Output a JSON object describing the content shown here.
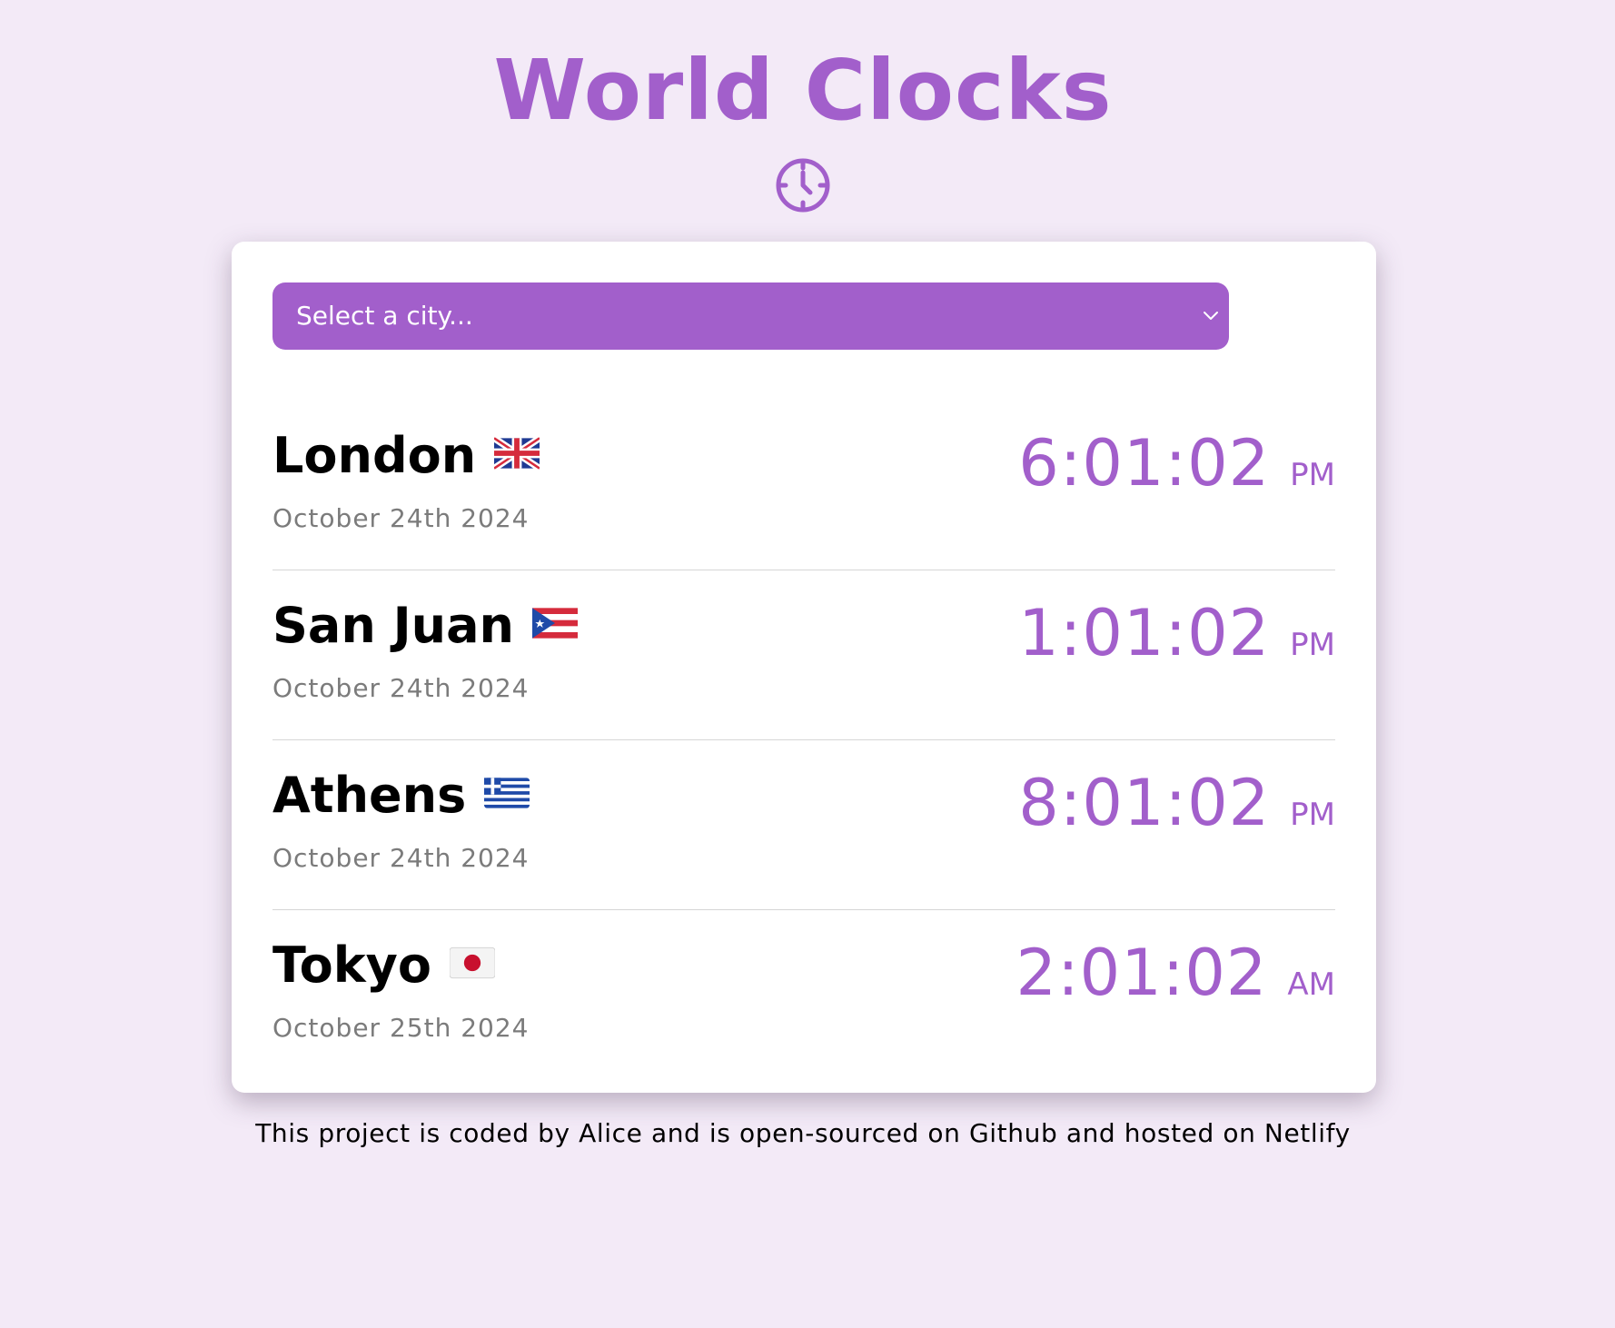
{
  "header": {
    "title": "World Clocks",
    "icon": "clock-icon",
    "accent_color": "#a25fcb"
  },
  "city_select": {
    "selected_label": "Select a city...",
    "icon": "chevron-down-icon"
  },
  "cities": [
    {
      "name": "London",
      "flag": "uk-flag-icon",
      "date": "October 24th 2024",
      "time": "6:01:02",
      "ampm": "PM"
    },
    {
      "name": "San Juan",
      "flag": "puerto-rico-flag-icon",
      "date": "October 24th 2024",
      "time": "1:01:02",
      "ampm": "PM"
    },
    {
      "name": "Athens",
      "flag": "greece-flag-icon",
      "date": "October 24th 2024",
      "time": "8:01:02",
      "ampm": "PM"
    },
    {
      "name": "Tokyo",
      "flag": "japan-flag-icon",
      "date": "October 25th 2024",
      "time": "2:01:02",
      "ampm": "AM"
    }
  ],
  "footer": {
    "text": "This project is coded by Alice and is open-sourced on Github and hosted on Netlify"
  },
  "colors": {
    "background": "#f3eaf7",
    "card": "#ffffff",
    "date_text": "#7b7b7b"
  }
}
